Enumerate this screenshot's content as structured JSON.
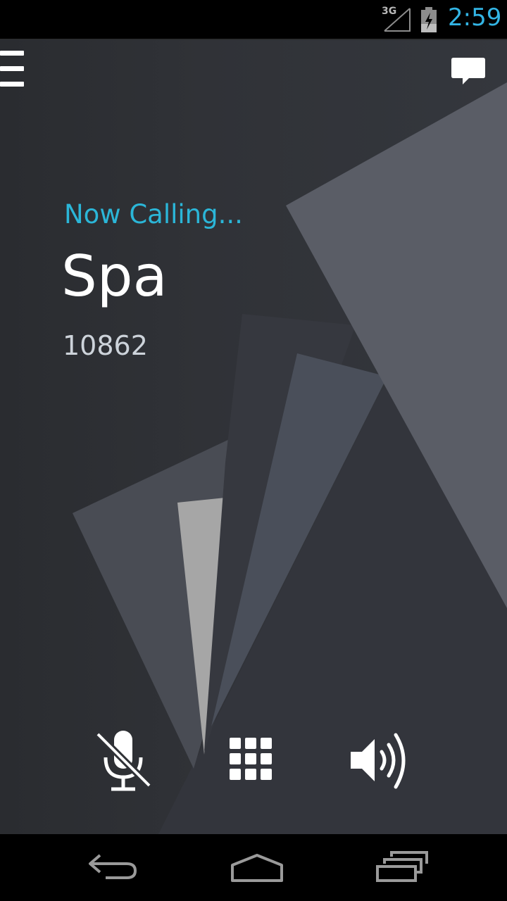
{
  "status_bar": {
    "network": "3G",
    "time": "2:59",
    "icons": [
      "signal-icon",
      "battery-charging-icon"
    ]
  },
  "call": {
    "status": "Now Calling...",
    "contact_name": "Spa",
    "contact_number": "10862"
  },
  "header": {
    "menu_icon": "menu-icon",
    "chat_icon": "chat-icon"
  },
  "controls": [
    {
      "name": "mute",
      "icon": "microphone-muted-icon"
    },
    {
      "name": "dialpad",
      "icon": "dialpad-icon"
    },
    {
      "name": "speaker",
      "icon": "speaker-icon"
    }
  ],
  "nav_bar": {
    "icons": [
      "back-icon",
      "home-icon",
      "recent-apps-icon"
    ]
  },
  "colors": {
    "accent": "#33b5e5",
    "background": "#2c2e33",
    "status_text": "#2bb6d8"
  }
}
